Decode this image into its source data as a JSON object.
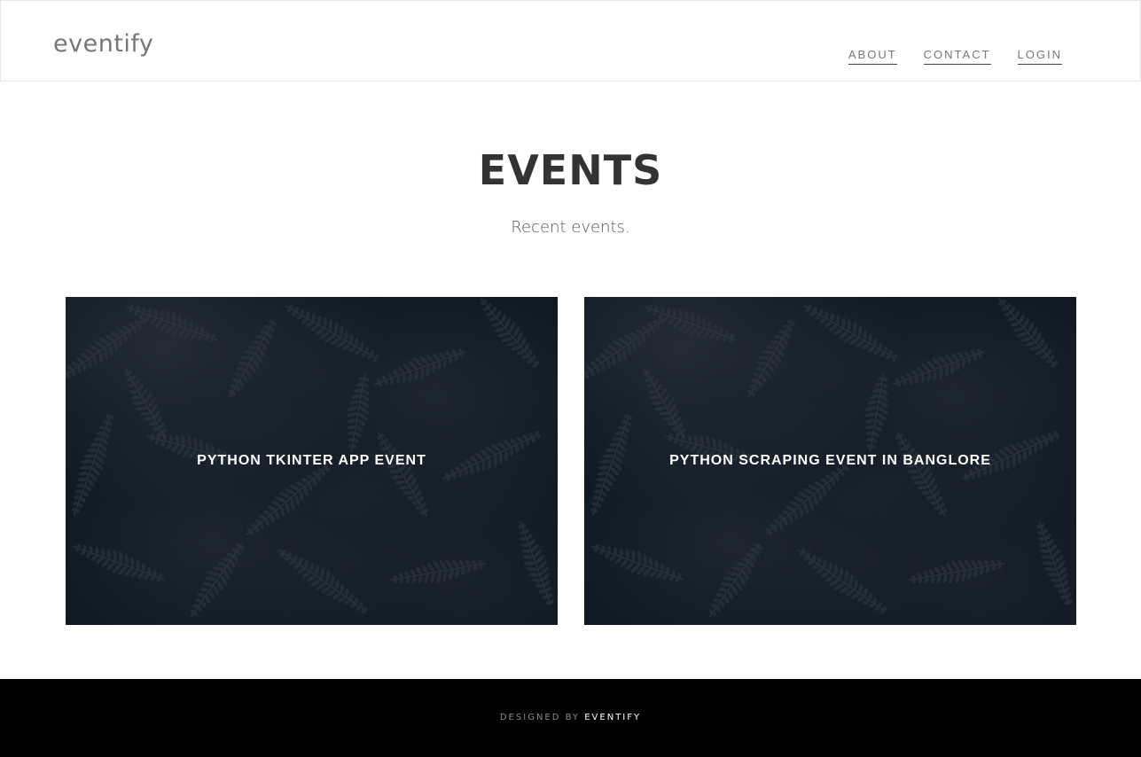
{
  "header": {
    "brand": "eventify",
    "nav": [
      {
        "label": "ABOUT"
      },
      {
        "label": "CONTACT"
      },
      {
        "label": "LOGIN"
      }
    ]
  },
  "main": {
    "title": "EVENTS",
    "subtitle": "Recent events.",
    "events": [
      {
        "title": "PYTHON TKINTER APP EVENT"
      },
      {
        "title": "PYTHON SCRAPING EVENT IN BANGLORE"
      }
    ]
  },
  "footer": {
    "prefix": "DESIGNED BY",
    "brand": "EVENTIFY"
  },
  "colors": {
    "card_bg": "#0b1620",
    "footer_bg": "#000000",
    "text_dark": "#333333",
    "nav_text": "#777777"
  },
  "icons": [
    "fern-leaf-pattern"
  ]
}
